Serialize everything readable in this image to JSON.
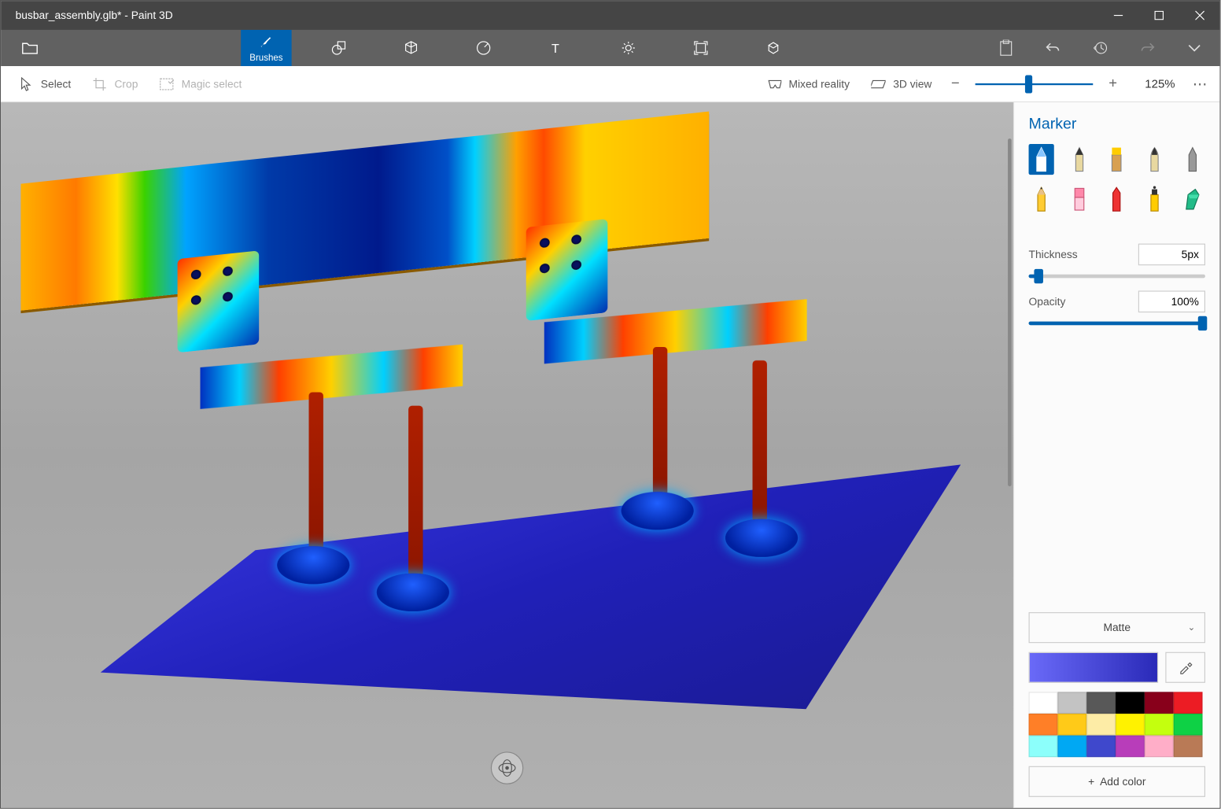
{
  "title": "busbar_assembly.glb* - Paint 3D",
  "ribbon": {
    "tabs": [
      "Brushes"
    ],
    "tab_names": [
      "brushes",
      "2d-shapes",
      "3d-shapes",
      "stickers",
      "text",
      "effects",
      "canvas",
      "3d-library"
    ]
  },
  "toolbar": {
    "select": "Select",
    "crop": "Crop",
    "magic": "Magic select",
    "mixed": "Mixed reality",
    "view3d": "3D view",
    "zoom_pct": "125%",
    "zoom_slider_pos": 0.42
  },
  "side": {
    "title": "Marker",
    "thickness_label": "Thickness",
    "thickness_value": "5px",
    "thickness_pos": 0.05,
    "opacity_label": "Opacity",
    "opacity_value": "100%",
    "opacity_pos": 1.0,
    "material": "Matte",
    "add_color": "Add color",
    "palette": [
      "#ffffff",
      "#c3c3c3",
      "#585858",
      "#000000",
      "#88001b",
      "#ec1c24",
      "#ff7f27",
      "#ffca18",
      "#fdeca6",
      "#fff200",
      "#c4ff0e",
      "#0ed145",
      "#8cfffb",
      "#00a8f3",
      "#3f48cc",
      "#b83dba",
      "#ffaec8",
      "#b97a56"
    ],
    "brush_names": [
      "marker",
      "calligraphy-pen",
      "oil-brush",
      "watercolor",
      "pixel-pen",
      "pencil",
      "eraser",
      "crayon",
      "spray-can",
      "fill"
    ]
  }
}
